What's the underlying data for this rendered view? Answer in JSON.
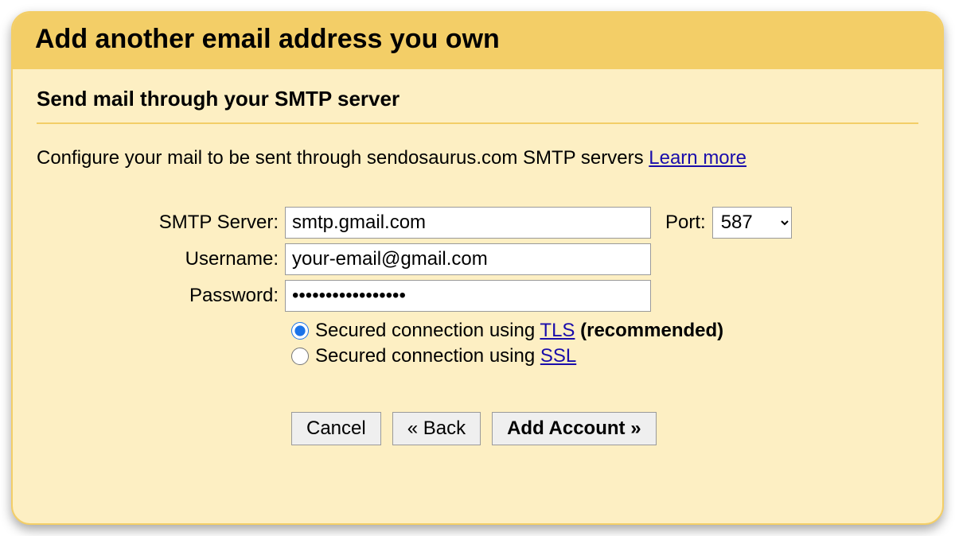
{
  "dialog": {
    "title": "Add another email address you own",
    "subheading": "Send mail through your SMTP server",
    "description_prefix": "Configure your mail to be sent through sendosaurus.com SMTP servers ",
    "learn_more": "Learn more"
  },
  "form": {
    "smtp_label": "SMTP Server:",
    "smtp_value": "smtp.gmail.com",
    "port_label": "Port:",
    "port_value": "587",
    "username_label": "Username:",
    "username_value": "your-email@gmail.com",
    "password_label": "Password:",
    "password_value": "•••••••••••••••••",
    "radio_tls_prefix": "Secured connection using ",
    "radio_tls_link": "TLS",
    "radio_tls_suffix": " (recommended)",
    "radio_ssl_prefix": "Secured connection using ",
    "radio_ssl_link": "SSL"
  },
  "buttons": {
    "cancel": "Cancel",
    "back": "« Back",
    "add": "Add Account »"
  }
}
